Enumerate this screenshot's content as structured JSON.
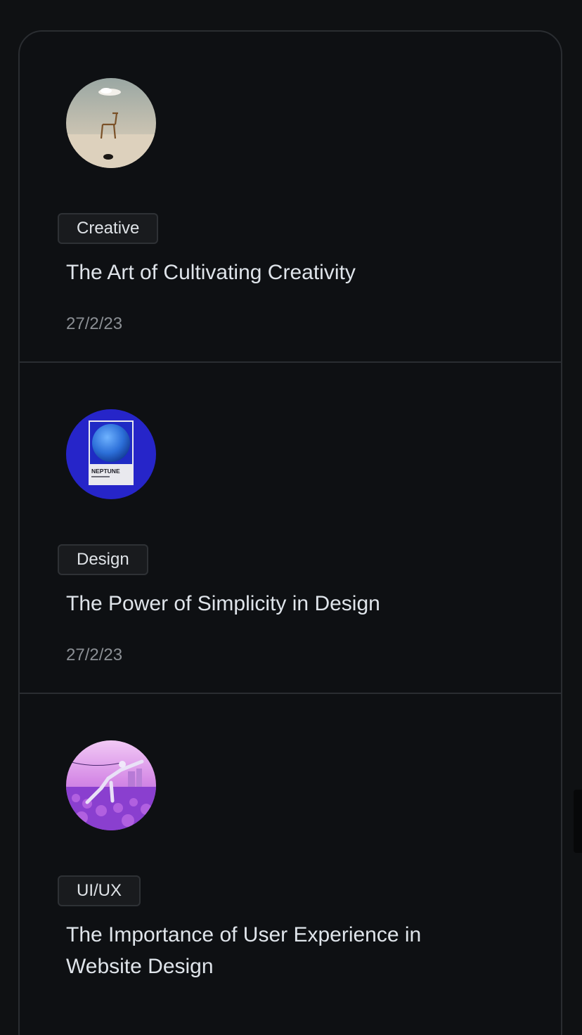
{
  "posts": [
    {
      "tag": "Creative",
      "title": "The Art of Cultivating Creativity",
      "date": "27/2/23",
      "image_icon": "desert-chair-image"
    },
    {
      "tag": "Design",
      "title": "The Power of Simplicity in Design",
      "date": "27/2/23",
      "image_icon": "neptune-poster-image",
      "image_text": "NEPTUNE"
    },
    {
      "tag": "UI/UX",
      "title": "The Importance of User Experience in Website Design",
      "date": "",
      "image_icon": "purple-field-figure-image"
    }
  ],
  "colors": {
    "background": "#0f1113",
    "card_border": "#2a2d31",
    "tag_background": "#191b1e",
    "title_text": "#dfe4ea",
    "date_text": "#8b8f94"
  }
}
